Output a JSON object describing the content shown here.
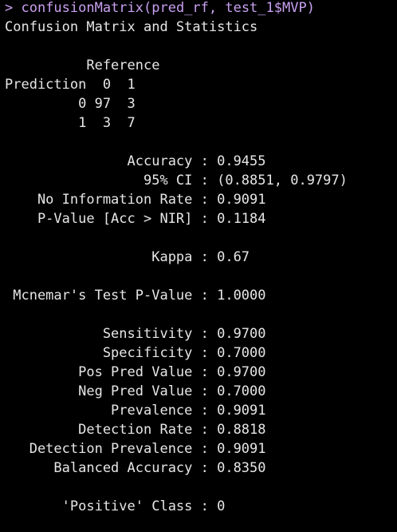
{
  "prompt": "> ",
  "command": "confusionMatrix(pred_rf, test_1$MVP)",
  "output": {
    "title": "Confusion Matrix and Statistics",
    "reference_header": "          Reference",
    "prediction_header": "Prediction  0  1",
    "row_0": "         0 97  3",
    "row_1": "         1  3  7",
    "stats": [
      "               Accuracy : 0.9455",
      "                 95% CI : (0.8851, 0.9797)",
      "    No Information Rate : 0.9091",
      "    P-Value [Acc > NIR] : 0.1184",
      "",
      "                  Kappa : 0.67",
      "",
      " Mcnemar's Test P-Value : 1.0000",
      "",
      "            Sensitivity : 0.9700",
      "            Specificity : 0.7000",
      "         Pos Pred Value : 0.9700",
      "         Neg Pred Value : 0.7000",
      "             Prevalence : 0.9091",
      "         Detection Rate : 0.8818",
      "   Detection Prevalence : 0.9091",
      "      Balanced Accuracy : 0.8350",
      "",
      "       'Positive' Class : 0"
    ]
  }
}
